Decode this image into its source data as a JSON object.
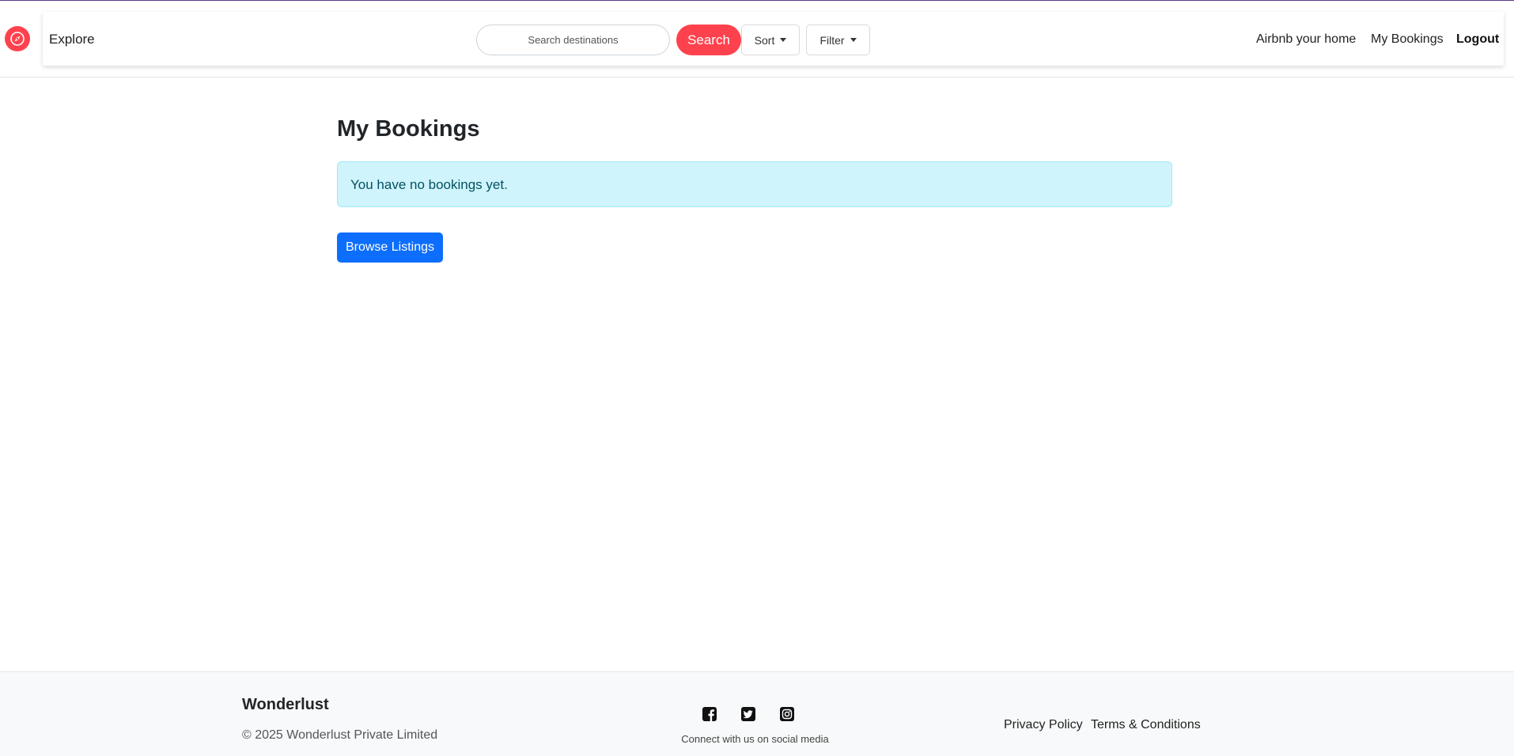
{
  "colors": {
    "brand": "#fe424d",
    "primary": "#0d6efd",
    "alert_bg": "#cff4fc",
    "alert_text": "#055160"
  },
  "navbar": {
    "logo_icon": "compass-icon",
    "explore_label": "Explore",
    "search": {
      "placeholder": "Search destinations",
      "value": "",
      "button_label": "Search"
    },
    "sort_label": "Sort",
    "filter_label": "Filter",
    "links": {
      "host": "Airbnb your home",
      "bookings": "My Bookings",
      "logout": "Logout"
    }
  },
  "main": {
    "title": "My Bookings",
    "alert": "You have no bookings yet.",
    "browse_button": "Browse Listings"
  },
  "footer": {
    "brand": "Wonderlust",
    "copyright": "© 2025 Wonderlust Private Limited",
    "social_icons": [
      "facebook-icon",
      "twitter-icon",
      "instagram-icon"
    ],
    "connect_text": "Connect with us on social media",
    "privacy": "Privacy Policy",
    "terms": "Terms & Conditions"
  }
}
